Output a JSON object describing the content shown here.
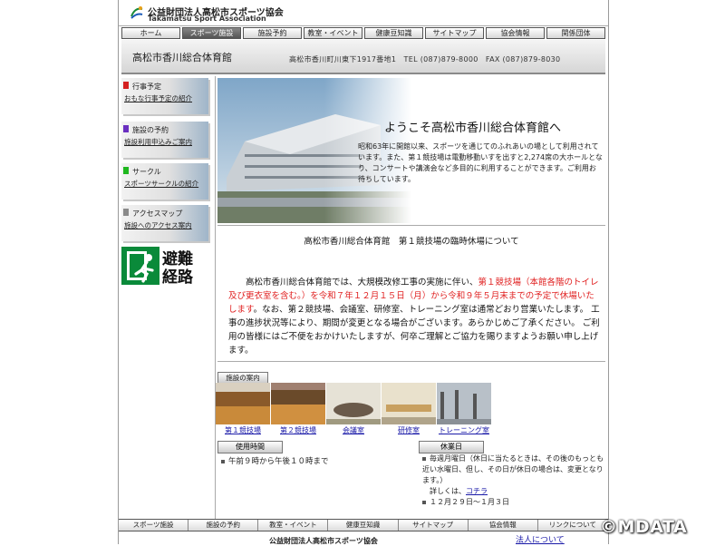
{
  "header": {
    "org_name_jp": "公益財団法人高松市スポーツ協会",
    "org_name_en": "Takamatsu Sport Association"
  },
  "nav": {
    "items": [
      "ホーム",
      "スポーツ施設",
      "施設予約",
      "教室・イベント",
      "健康豆知識",
      "サイトマップ",
      "協会情報",
      "関係団体"
    ]
  },
  "titlebar": {
    "facility_name": "高松市香川総合体育館",
    "address_contact": "高松市香川町川東下1917番地1　TEL (087)879-8000　FAX (087)879-8030"
  },
  "sidebar": {
    "items": [
      {
        "title": "行事予定",
        "subtitle": "おもな行事予定の紹介",
        "color": "#d42020"
      },
      {
        "title": "施設の予約",
        "subtitle": "施設利用申込みご案内",
        "color": "#6a2fc0"
      },
      {
        "title": "サークル",
        "subtitle": "スポーツサークルの紹介",
        "color": "#1fb81f"
      },
      {
        "title": "アクセスマップ",
        "subtitle": "施設へのアクセス案内",
        "color": "#8a8a8a"
      }
    ],
    "exit_sign_text": "避難経路",
    "exit_sign_color": "#0a8a3a"
  },
  "hero": {
    "title": "ようこそ高松市香川総合体育館へ",
    "body": "昭和63年に開館以来、スポーツを通じてのふれあいの場として利用されています。また、第１競技場は電動移動いすを出すと2,274席の大ホールとなり、コンサートや講演会など多目的に利用することができます。ご利用お待ちしています。"
  },
  "notice": {
    "title": "高松市香川総合体育館　第１競技場の臨時休場について",
    "body_part1": "高松市香川総合体育館では、大規模改修工事の実施に伴い、",
    "body_red": "第１競技場（本館各階のトイレ及び更衣室を含む。）を令和７年１２月１５日（月）から令和９年５月末までの予定で休場いたします",
    "body_part2": "。なお、第２競技場、会議室、研修室、トレーニング室は通常どおり営業いたします。 工事の進捗状況等により、期間が変更となる場合がございます。あらかじめご了承ください。 ご利用の皆様にはご不便をおかけいたしますが、何卒ご理解とご協力を賜りますようお願い申し上げます。"
  },
  "facilities": {
    "label": "施設の案内",
    "items": [
      "第１競技場",
      "第２競技場",
      "会議室",
      "研修室",
      "トレーニング室"
    ]
  },
  "hours": {
    "label": "使用時間",
    "text": "午前９時から午後１０時まで"
  },
  "closed": {
    "label": "休業日",
    "line1": "毎週月曜日（休日に当たるときは、その後のもっとも近い水曜日、但し、その日が休日の場合は、変更となります。）",
    "details_prefix": "詳しくは、",
    "details_link": "コチラ",
    "line2": "１２月２９日〜１月３日"
  },
  "footer": {
    "nav_items": [
      "スポーツ施設",
      "施設の予約",
      "教室・イベント",
      "健康豆知識",
      "サイトマップ",
      "協会情報",
      "リンクについて"
    ],
    "org_name": "公益財団法人高松市スポーツ協会",
    "link_text": "法人について"
  },
  "watermark": "©MDATA"
}
